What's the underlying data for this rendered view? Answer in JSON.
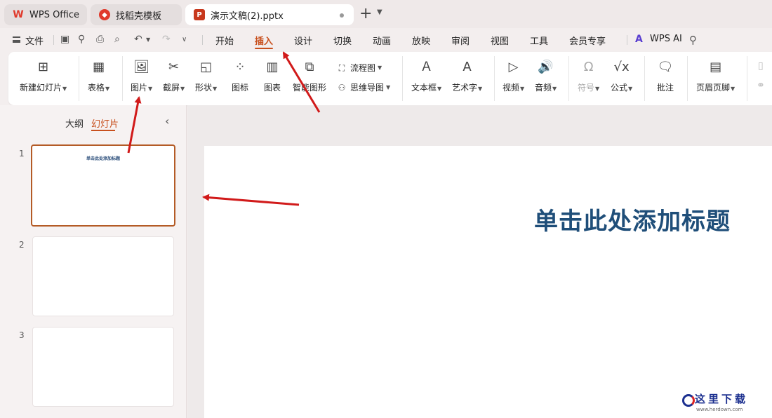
{
  "tabs": [
    {
      "label": "WPS Office",
      "icon": "wps-logo-icon"
    },
    {
      "label": "找稻壳模板",
      "icon": "docer-icon"
    },
    {
      "label": "演示文稿(2).pptx",
      "icon": "ppt-file-icon",
      "icon_letter": "P"
    }
  ],
  "tab_add": "+",
  "menu": {
    "file": "文件",
    "items": [
      "开始",
      "插入",
      "设计",
      "切换",
      "动画",
      "放映",
      "审阅",
      "视图",
      "工具",
      "会员专享"
    ],
    "active": "插入",
    "wps_ai": "WPS AI"
  },
  "ribbon": {
    "new_slide": "新建幻灯片",
    "table": "表格",
    "picture": "图片",
    "screenshot": "截屏",
    "shape": "形状",
    "icon": "图标",
    "chart": "图表",
    "smart_graphic": "智能图形",
    "flowchart": "流程图",
    "mindmap": "思维导图",
    "textbox": "文本框",
    "wordart": "艺术字",
    "video": "视频",
    "audio": "音频",
    "symbol": "符号",
    "formula": "公式",
    "comment": "批注",
    "header_footer": "页眉页脚"
  },
  "panel": {
    "outline_tab": "大纲",
    "slides_tab": "幻灯片",
    "active_tab": "幻灯片",
    "slides": [
      {
        "number": "1",
        "title": "单击此处添加标题",
        "selected": true
      },
      {
        "number": "2",
        "title": "",
        "selected": false
      },
      {
        "number": "3",
        "title": "",
        "selected": false
      }
    ]
  },
  "slide": {
    "title": "单击此处添加标题"
  },
  "colors": {
    "accent": "#c8501e",
    "title_blue": "#1f4e79",
    "arrow_red": "#d11a1a"
  },
  "watermark": {
    "text": "这里下载",
    "sub": "www.herdown.com"
  }
}
